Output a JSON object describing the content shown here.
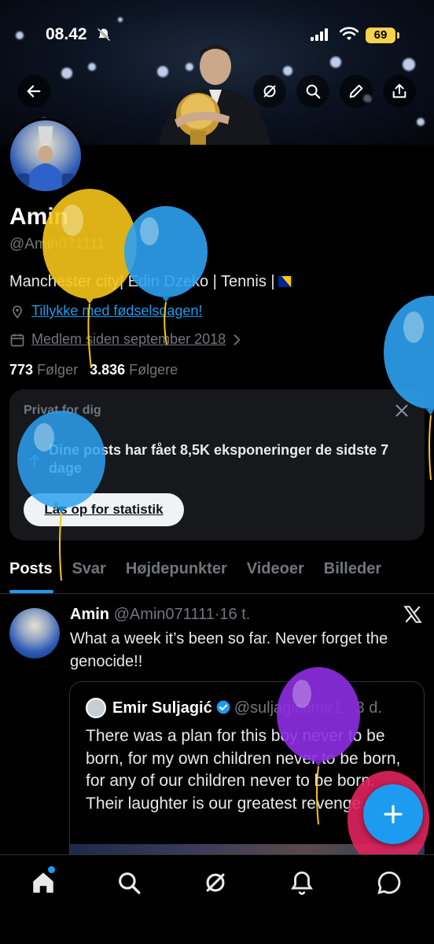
{
  "status_bar": {
    "time": "08.42",
    "battery": "69"
  },
  "profile": {
    "name": "Amin",
    "handle": "@Amin071111",
    "bio": "Manchester city| Edin Dzeko | Tennis |",
    "birthday_link": "Tillykke med fødselsdagen!",
    "joined": "Medlem siden september 2018",
    "following_count": "773",
    "following_label": "Følger",
    "followers_count": "3.836",
    "followers_label": "Følgere"
  },
  "private_card": {
    "title": "Privat for dig",
    "message": "Dine posts har fået 8,5K eksponeringer de sidste 7 dage",
    "button": "Lås op for statistik"
  },
  "tabs": [
    {
      "label": "Posts",
      "active": true
    },
    {
      "label": "Svar"
    },
    {
      "label": "Højdepunkter"
    },
    {
      "label": "Videoer"
    },
    {
      "label": "Billeder"
    }
  ],
  "post": {
    "author": "Amin",
    "handle": "@Amin071111",
    "time": "16 t.",
    "text": "What a week it’s been so far. Never forget the genocide!!",
    "quote": {
      "author": "Emir Suljagić",
      "handle": "@suljagicemir1",
      "time": "3 d.",
      "text": "There was a plan for this boy never to be born, for my own children never to be born, for any of our children never to be born. Their laughter is our greatest revenge."
    }
  },
  "colors": {
    "accent": "#1d9bf0",
    "background": "#000000",
    "muted": "#71767b"
  },
  "icons": [
    "back-arrow-icon",
    "grok-icon",
    "search-icon",
    "edit-icon",
    "share-icon",
    "location-icon",
    "calendar-icon",
    "chevron-right-icon",
    "close-icon",
    "x-logo-icon",
    "verified-icon",
    "plus-icon",
    "home-icon",
    "bell-icon",
    "messages-icon"
  ]
}
